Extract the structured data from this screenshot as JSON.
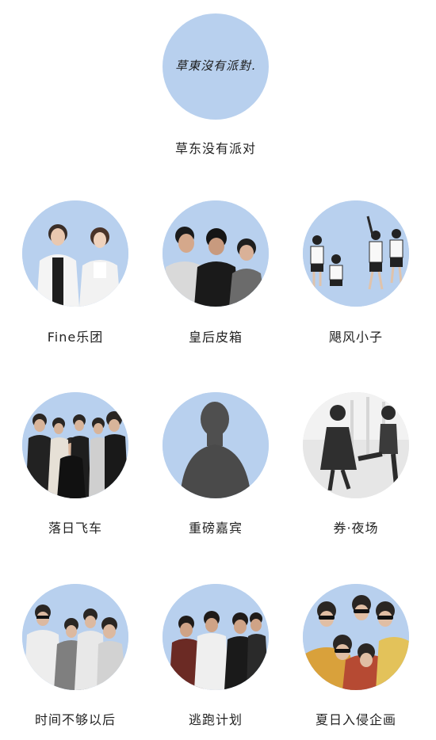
{
  "colors": {
    "avatar_bg": "#b8d0ee",
    "text": "#222222",
    "grey_bg": "#e6e6e6"
  },
  "headliner": {
    "logo_text": "草東沒有派對.",
    "name": "草东没有派对"
  },
  "artists": [
    {
      "name": "Fine乐团",
      "photo": "two-members-photo"
    },
    {
      "name": "皇后皮箱",
      "photo": "three-members-photo"
    },
    {
      "name": "飓风小子",
      "photo": "group-jumping-photo"
    },
    {
      "name": "落日飞车",
      "photo": "band-photo"
    },
    {
      "name": "重磅嘉宾",
      "photo": "mystery-silhouette"
    },
    {
      "name": "券·夜场",
      "photo": "dancers-photo"
    },
    {
      "name": "时间不够以后",
      "photo": "band-photo"
    },
    {
      "name": "逃跑计划",
      "photo": "band-photo"
    },
    {
      "name": "夏日入侵企画",
      "photo": "band-selfie-photo"
    }
  ]
}
